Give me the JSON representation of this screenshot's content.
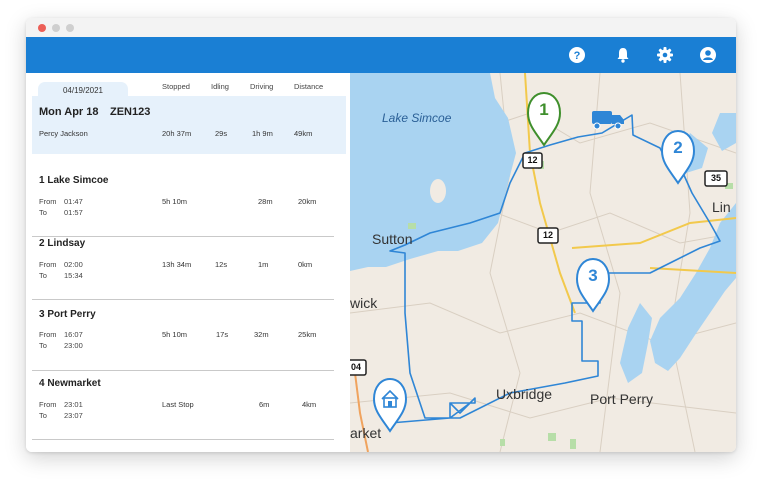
{
  "window": {
    "colors": {
      "close": "#ec5f57",
      "minimize": "#cfcfcf",
      "zoom": "#cfcfcf"
    }
  },
  "appbar": {
    "color": "#1a7fd4",
    "icons": [
      "help-icon",
      "bell-icon",
      "gear-icon",
      "user-icon"
    ]
  },
  "panel": {
    "date": "04/19/2021",
    "columns": {
      "stopped": "Stopped",
      "idling": "Idling",
      "driving": "Driving",
      "distance": "Distance"
    },
    "summary": {
      "title": "Mon Apr 18",
      "vehicle": "ZEN123",
      "driver": "Percy Jackson",
      "stopped": "20h 37m",
      "idling": "29s",
      "driving": "1h 9m",
      "distance": "49km"
    },
    "from_label": "From",
    "to_label": "To",
    "stops": [
      {
        "name": "1 Lake Simcoe",
        "from": "01:47",
        "to": "01:57",
        "stopped": "5h 10m",
        "idling": "",
        "driving": "28m",
        "distance": "20km"
      },
      {
        "name": "2 Lindsay",
        "from": "02:00",
        "to": "15:34",
        "stopped": "13h 34m",
        "idling": "12s",
        "driving": "1m",
        "distance": "0km"
      },
      {
        "name": "3 Port Perry",
        "from": "16:07",
        "to": "23:00",
        "stopped": "5h 10m",
        "idling": "17s",
        "driving": "32m",
        "distance": "25km"
      },
      {
        "name": "4 Newmarket",
        "from": "23:01",
        "to": "23:07",
        "stopped": "Last Stop",
        "idling": "",
        "driving": "6m",
        "distance": "4km"
      }
    ]
  },
  "map": {
    "labels": {
      "lake": "Lake Simcoe",
      "sutton": "Sutton",
      "wick": "wick",
      "uxbridge": "Uxbridge",
      "port_perry": "Port Perry",
      "market": "arket",
      "lin": "Lin"
    },
    "shields": {
      "s12a": "12",
      "s12b": "12",
      "s35": "35",
      "s04": "04"
    },
    "markers": {
      "m1": "1",
      "m2": "2",
      "m3": "3"
    },
    "colors": {
      "route": "#2f86d6",
      "marker_green": "#3f8f2c",
      "marker_blue": "#2f86d6",
      "water": "#a9d3f1",
      "land": "#f1ebe3",
      "road_yellow": "#f2c94c"
    }
  }
}
